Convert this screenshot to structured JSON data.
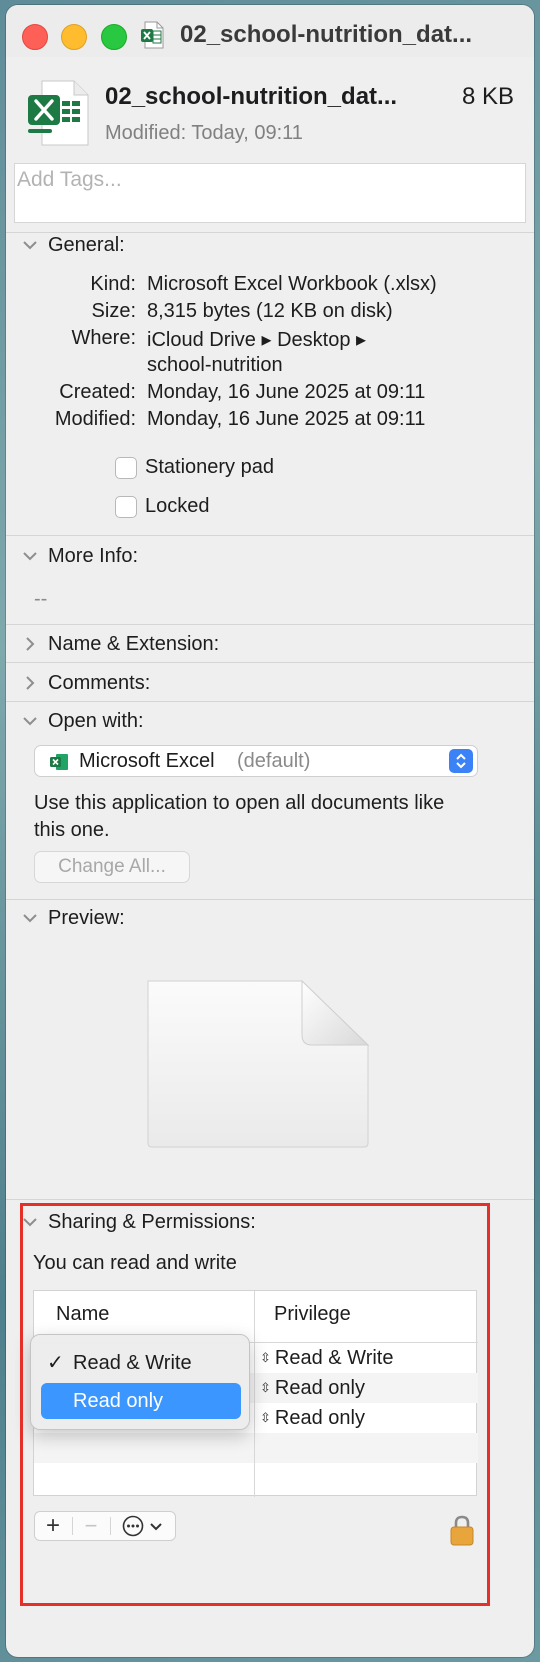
{
  "window": {
    "title": "02_school-nutrition_dat..."
  },
  "header": {
    "file_name": "02_school-nutrition_dat...",
    "file_size": "8 KB",
    "modified": "Modified: Today, 09:11"
  },
  "tags": {
    "placeholder": "Add Tags..."
  },
  "general": {
    "title": "General:",
    "kind_label": "Kind:",
    "kind": "Microsoft Excel Workbook (.xlsx)",
    "size_label": "Size:",
    "size": "8,315 bytes (12 KB on disk)",
    "where_label": "Where:",
    "where_line1": "iCloud Drive ▸ Desktop ▸",
    "where_line2": "school-nutrition",
    "created_label": "Created:",
    "created": "Monday, 16 June 2025 at 09:11",
    "modified_label": "Modified:",
    "modified": "Monday, 16 June 2025 at 09:11",
    "stationery_label": "Stationery pad",
    "locked_label": "Locked"
  },
  "more_info": {
    "title": "More Info:",
    "value": "--"
  },
  "name_extension": {
    "title": "Name & Extension:"
  },
  "comments": {
    "title": "Comments:"
  },
  "open_with": {
    "title": "Open with:",
    "app_name": "Microsoft Excel",
    "app_default": "(default)",
    "help_text": "Use this application to open all documents like this one.",
    "change_all": "Change All..."
  },
  "preview": {
    "title": "Preview:"
  },
  "sharing": {
    "title": "Sharing & Permissions:",
    "summary": "You can read and write",
    "col_name": "Name",
    "col_privilege": "Privilege",
    "rows": [
      {
        "privilege": "Read & Write"
      },
      {
        "privilege": "Read only"
      },
      {
        "privilege": "Read only"
      }
    ],
    "menu": {
      "items": [
        {
          "label": "Read & Write",
          "check": "✓"
        },
        {
          "label": "Read only",
          "check": ""
        }
      ]
    }
  },
  "bottom": {
    "add": "+",
    "remove": "−"
  },
  "colors": {
    "accent": "#3b97ff",
    "highlight": "#e5302a",
    "excel_green": "#1d7a45"
  },
  "icons": [
    "excel-file-icon",
    "chevron-down-icon",
    "chevron-right-icon",
    "updown-icon",
    "lock-icon",
    "ellipsis-icon"
  ]
}
